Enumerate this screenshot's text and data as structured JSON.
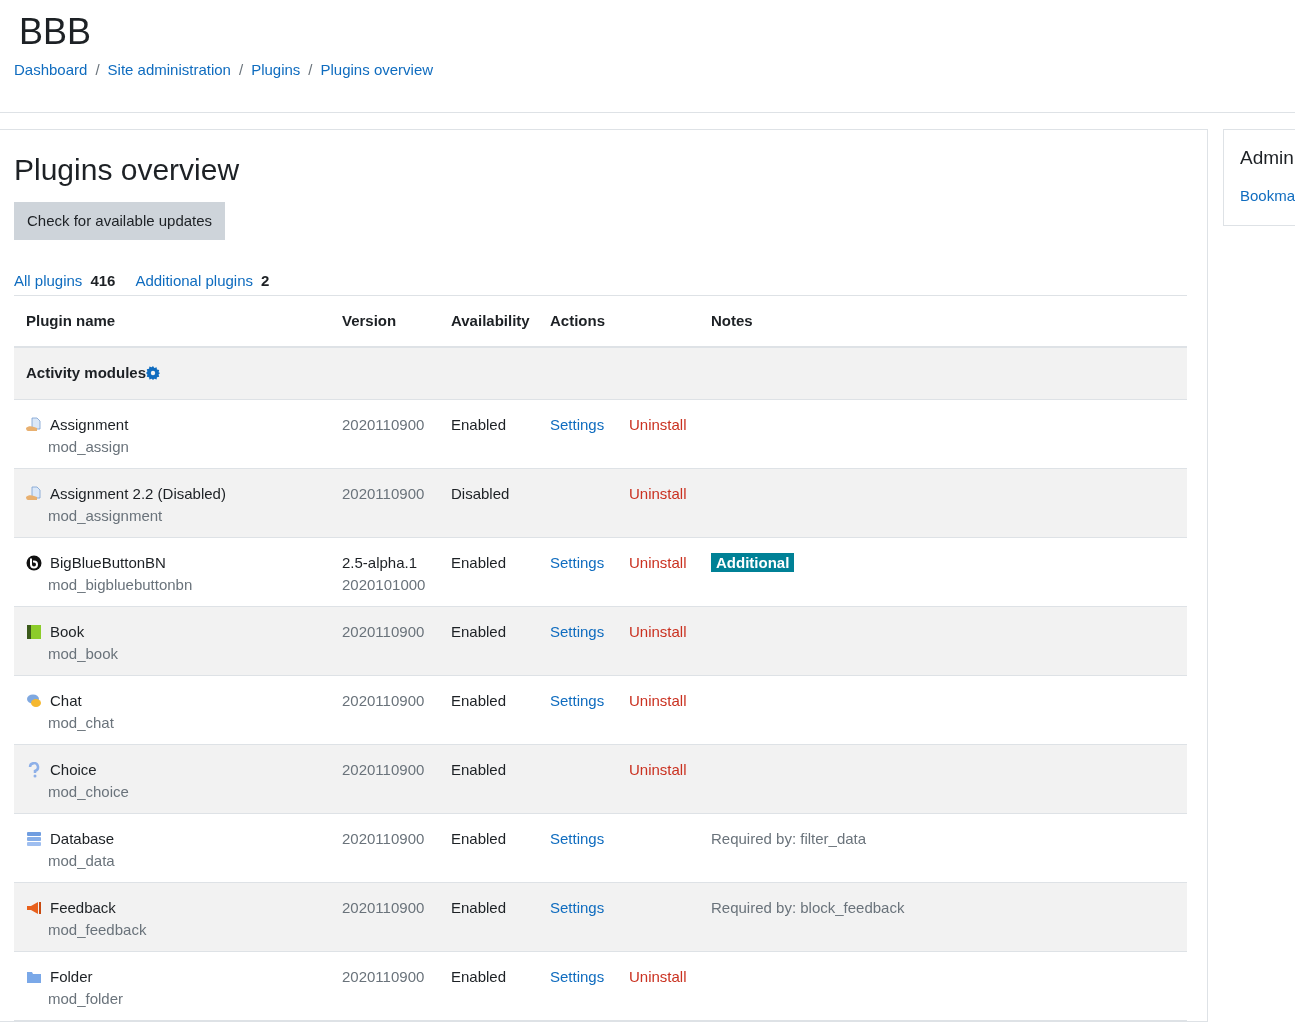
{
  "site_name": "BBB",
  "breadcrumb": [
    {
      "label": "Dashboard"
    },
    {
      "separator": "/",
      "label": "Site administration"
    },
    {
      "separator": "/",
      "label": "Plugins"
    },
    {
      "separator": "/",
      "label": "Plugins overview"
    }
  ],
  "page_title": "Plugins overview",
  "check_button": "Check for available updates",
  "filters": [
    {
      "label": "All plugins",
      "count": "416"
    },
    {
      "label": "Additional plugins",
      "count": "2"
    }
  ],
  "table": {
    "columns": [
      "Plugin name",
      "Version",
      "Availability",
      "Actions",
      "Notes"
    ],
    "group": "Activity modules",
    "rows": [
      {
        "name": "Assignment",
        "component": "mod_assign",
        "version": [
          "2020110900"
        ],
        "availability": "Enabled",
        "settings": "Settings",
        "uninstall": "Uninstall"
      },
      {
        "name": "Assignment 2.2 (Disabled)",
        "component": "mod_assignment",
        "version": [
          "2020110900"
        ],
        "availability": "Disabled",
        "uninstall": "Uninstall"
      },
      {
        "name": "BigBlueButtonBN",
        "component": "mod_bigbluebuttonbn",
        "version": [
          "2.5-alpha.1",
          "2020101000"
        ],
        "availability": "Enabled",
        "settings": "Settings",
        "uninstall": "Uninstall",
        "badge": "Additional"
      },
      {
        "name": "Book",
        "component": "mod_book",
        "version": [
          "2020110900"
        ],
        "availability": "Enabled",
        "settings": "Settings",
        "uninstall": "Uninstall"
      },
      {
        "name": "Chat",
        "component": "mod_chat",
        "version": [
          "2020110900"
        ],
        "availability": "Enabled",
        "settings": "Settings",
        "uninstall": "Uninstall"
      },
      {
        "name": "Choice",
        "component": "mod_choice",
        "version": [
          "2020110900"
        ],
        "availability": "Enabled",
        "uninstall": "Uninstall"
      },
      {
        "name": "Database",
        "component": "mod_data",
        "version": [
          "2020110900"
        ],
        "availability": "Enabled",
        "settings": "Settings",
        "note": "Required by: filter_data"
      },
      {
        "name": "Feedback",
        "component": "mod_feedback",
        "version": [
          "2020110900"
        ],
        "availability": "Enabled",
        "settings": "Settings",
        "note": "Required by: block_feedback"
      },
      {
        "name": "Folder",
        "component": "mod_folder",
        "version": [
          "2020110900"
        ],
        "availability": "Enabled",
        "settings": "Settings",
        "uninstall": "Uninstall"
      }
    ]
  },
  "side_block": {
    "title": "Admin",
    "link": "Bookma"
  }
}
